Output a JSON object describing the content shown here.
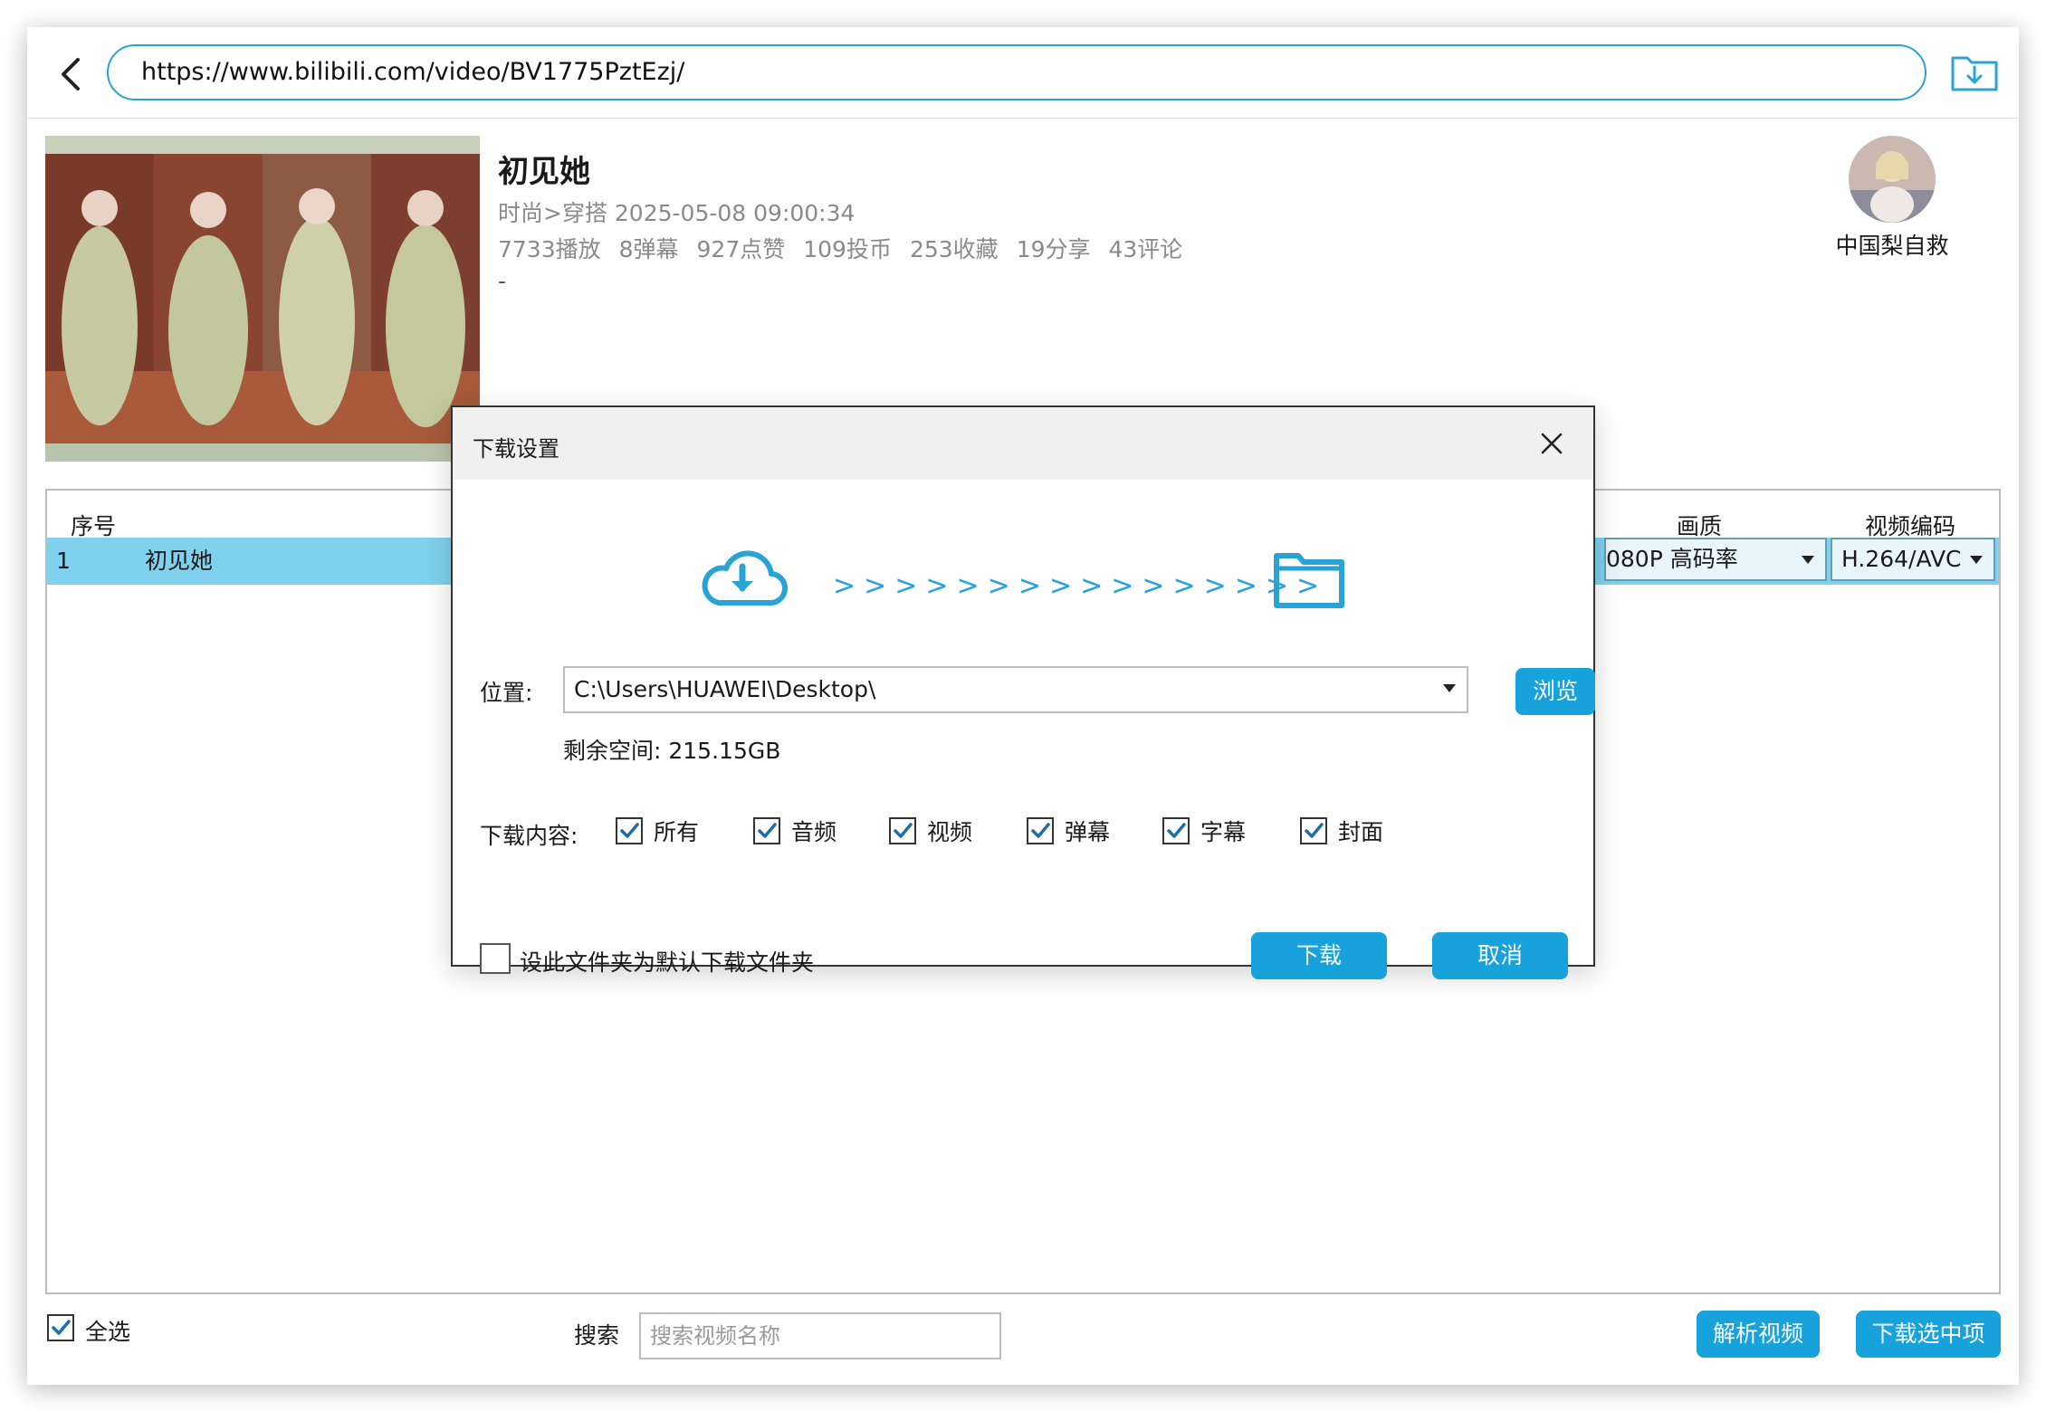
{
  "url": "https://www.bilibili.com/video/BV1775PztEzj/",
  "video": {
    "title": "初见她",
    "category_date": "时尚>穿搭   2025-05-08 09:00:34",
    "stats": [
      "7733播放",
      "8弹幕",
      "927点赞",
      "109投币",
      "253收藏",
      "19分享",
      "43评论"
    ],
    "desc": "-"
  },
  "uploader": {
    "name": "中国梨自救"
  },
  "table": {
    "headers": {
      "index": "序号",
      "quality": "画质",
      "codec": "视频编码"
    },
    "rows": [
      {
        "index": "1",
        "name": "初见她",
        "quality": "080P 高码率",
        "codec": "H.264/AVC"
      }
    ]
  },
  "bottom": {
    "select_all": "全选",
    "search_label": "搜索",
    "search_placeholder": "搜索视频名称",
    "parse_btn": "解析视频",
    "download_selected_btn": "下载选中项"
  },
  "dialog": {
    "title": "下载设置",
    "arrows": ">>>>>>>>>>>>>>>>",
    "location_label": "位置:",
    "location_value": "C:\\Users\\HUAWEI\\Desktop\\",
    "browse_btn": "浏览",
    "free_space": "剩余空间: 215.15GB",
    "content_label": "下载内容:",
    "options": [
      "所有",
      "音频",
      "视频",
      "弹幕",
      "字幕",
      "封面"
    ],
    "default_folder": "设此文件夹为默认下载文件夹",
    "download_btn": "下载",
    "cancel_btn": "取消"
  },
  "colors": {
    "accent": "#18a2dc",
    "selected_row": "#7fd1ee"
  }
}
